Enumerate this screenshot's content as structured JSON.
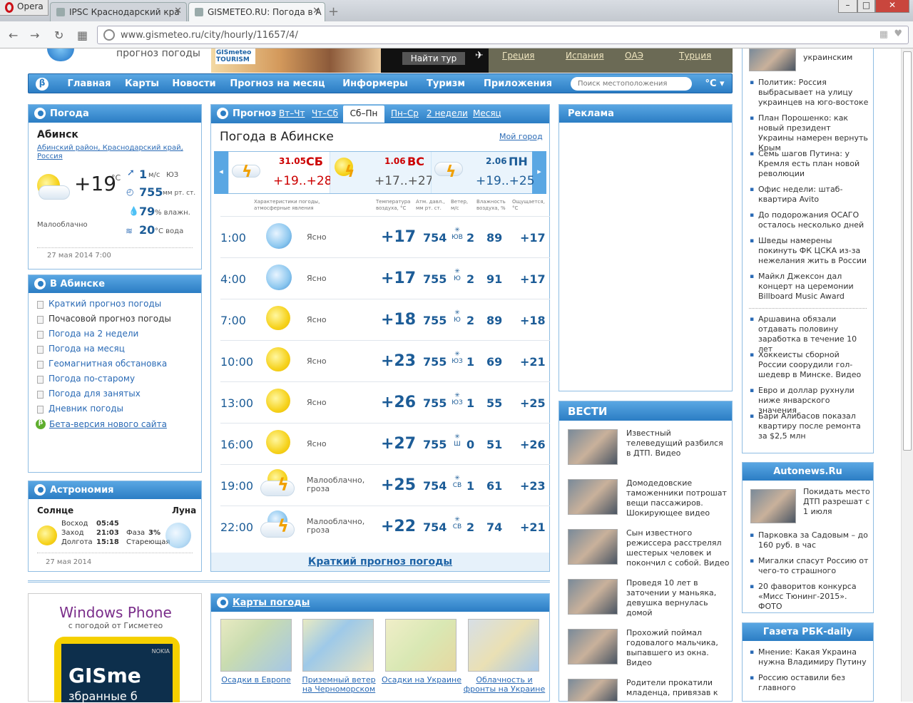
{
  "browser": {
    "opera_label": "Opera",
    "tabs": [
      {
        "label": "IPSC Краснодарский кра"
      },
      {
        "label": "GISMETEO.RU: Погода в А"
      }
    ],
    "url": "www.gismeteo.ru/city/hourly/11657/4/"
  },
  "header": {
    "tagline": "прогноз погоды",
    "ad_brand": "GISmeteo TOURISM",
    "find_tour": "Найти тур",
    "countries": [
      "Греция",
      "Испания",
      "ОАЭ",
      "Турция"
    ]
  },
  "nav": {
    "items": [
      "Главная",
      "Карты",
      "Новости",
      "Прогноз на месяц",
      "Информеры",
      "Туризм",
      "Приложения"
    ],
    "search_placeholder": "Поиск местоположения",
    "unit": "°C"
  },
  "weather_panel": {
    "title": "Погода",
    "city": "Абинск",
    "region": "Абинский район, Краснодарский край, Россия",
    "temp": "+19",
    "temp_unit": "°C",
    "condition": "Малооблачно",
    "wind_speed": "1",
    "wind_unit": "м/с",
    "wind_dir": "ЮЗ",
    "pressure": "755",
    "pressure_unit": "мм рт. ст.",
    "humidity": "79",
    "humidity_unit": "% влажн.",
    "water": "20",
    "water_unit": "°C вода",
    "date": "27 мая 2014 7:00"
  },
  "city_panel": {
    "title": "В Абинске",
    "links": [
      "Краткий прогноз погоды",
      "Почасовой прогноз погоды",
      "Погода на 2 недели",
      "Погода на месяц",
      "Геомагнитная обстановка",
      "Погода по-старому",
      "Погода для занятых",
      "Дневник погоды"
    ],
    "beta": "Бета-версия нового сайта"
  },
  "astro_panel": {
    "title": "Астрономия",
    "sun": "Солнце",
    "moon": "Луна",
    "rise_label": "Восход",
    "rise": "05:45",
    "set_label": "Заход",
    "set": "21:03",
    "len_label": "Долгота",
    "len": "15:18",
    "phase_label": "Фаза",
    "phase": "3%",
    "phase_name": "Стареющая",
    "date": "27 мая 2014"
  },
  "forecast": {
    "label": "Прогноз",
    "tabs": [
      "Вт–Чт",
      "Чт–Сб",
      "Сб–Пн",
      "Пн–Ср",
      "2 недели",
      "Месяц"
    ],
    "active_tab": "Сб–Пн",
    "title": "Погода в Абинске",
    "my_city": "Мой город",
    "days": [
      {
        "date": "31.05",
        "dow": "СБ",
        "range": "+19..+28"
      },
      {
        "date": "1.06",
        "dow": "ВС",
        "range": "+17..+27"
      },
      {
        "date": "2.06",
        "dow": "ПН",
        "range": "+19..+25"
      }
    ],
    "col_headers": {
      "cond": "Характеристики погоды, атмосферные явления",
      "temp": "Температура воздуха, °С",
      "pres": "Атм. давл., мм рт. ст.",
      "wind": "Ветер, м/с",
      "hum": "Влажность воздуха, %",
      "feel": "Ощущается, °С"
    },
    "rows": [
      {
        "time": "1:00",
        "desc": "Ясно",
        "temp": "+17",
        "pres": "754",
        "wdir": "ЮВ",
        "ws": "2",
        "hum": "89",
        "feel": "+17",
        "icon": "moon-icon"
      },
      {
        "time": "4:00",
        "desc": "Ясно",
        "temp": "+17",
        "pres": "755",
        "wdir": "Ю",
        "ws": "2",
        "hum": "91",
        "feel": "+17",
        "icon": "moon-icon"
      },
      {
        "time": "7:00",
        "desc": "Ясно",
        "temp": "+18",
        "pres": "755",
        "wdir": "Ю",
        "ws": "2",
        "hum": "89",
        "feel": "+18",
        "icon": "sun-icon"
      },
      {
        "time": "10:00",
        "desc": "Ясно",
        "temp": "+23",
        "pres": "755",
        "wdir": "ЮЗ",
        "ws": "1",
        "hum": "69",
        "feel": "+21",
        "icon": "sun-icon"
      },
      {
        "time": "13:00",
        "desc": "Ясно",
        "temp": "+26",
        "pres": "755",
        "wdir": "ЮЗ",
        "ws": "1",
        "hum": "55",
        "feel": "+25",
        "icon": "sun-icon"
      },
      {
        "time": "16:00",
        "desc": "Ясно",
        "temp": "+27",
        "pres": "755",
        "wdir": "Ш",
        "ws": "0",
        "hum": "51",
        "feel": "+26",
        "icon": "sun-icon"
      },
      {
        "time": "19:00",
        "desc": "Малооблачно, гроза",
        "temp": "+25",
        "pres": "754",
        "wdir": "СВ",
        "ws": "1",
        "hum": "61",
        "feel": "+23",
        "icon": "thunderstorm-icon"
      },
      {
        "time": "22:00",
        "desc": "Малооблачно, гроза",
        "temp": "+22",
        "pres": "754",
        "wdir": "СВ",
        "ws": "2",
        "hum": "74",
        "feel": "+21",
        "icon": "thunderstorm-icon"
      }
    ],
    "short_link": "Краткий прогноз погоды"
  },
  "maps_panel": {
    "title": "Карты погоды",
    "items": [
      "Осадки в Европе",
      "Приземный ветер на Черноморском",
      "Осадки на Украине",
      "Облачность и фронты на Украине"
    ]
  },
  "windows_phone": {
    "title": "Windows Phone",
    "subtitle": "с погодой от Гисметео",
    "brand": "NOKIA",
    "screen_text": "GISme",
    "screen_sub": "збранные б"
  },
  "ad_panel": {
    "title": "Реклама"
  },
  "vesti": {
    "title": "ВЕСТИ",
    "items": [
      "Известный телеведущий разбился в ДТП. Видео",
      "Домодедовские таможенники потрошат вещи пассажиров. Шокирующее видео",
      "Сын известного режиссера расстрелял шестерых человек и покончил с собой. Видео",
      "Проведя 10 лет в заточении у маньяка, девушка вернулась домой",
      "Прохожий поймал годовалого мальчика, выпавшего из окна. Видео",
      "Родители прокатили младенца, привязав к"
    ]
  },
  "news_col": {
    "top_fragment": "украинским",
    "items": [
      "Политик: Россия выбрасывает на улицу украинцев на юго-востоке",
      "План Порошенко: как новый президент Украины намерен вернуть Крым",
      "Семь шагов Путина: у Кремля есть план новой революции",
      "Офис недели: штаб-квартира Avito",
      "До подорожания ОСАГО осталось несколько дней",
      "Шведы намерены покинуть ФК ЦСКА из-за нежелания жить в России",
      "Майкл Джексон дал концерт на церемонии Billboard Music Award",
      "Аршавина обязали отдавать половину заработка в течение 10 лет",
      "Хоккеисты сборной России соорудили гол-шедевр в Минске. Видео",
      "Евро и доллар рухнули ниже январского значения",
      "Бари Алибасов показал квартиру после ремонта за $2,5 млн"
    ]
  },
  "autonews": {
    "title": "Autonews.Ru",
    "lead": "Покидать место ДТП разрешат с 1 июля",
    "items": [
      "Парковка за Садовым – до 160 руб. в час",
      "Мигалки спасут Россию от чего-то страшного",
      "20 фаворитов конкурса «Мисс Тюнинг-2015». ФОТО"
    ]
  },
  "rbc": {
    "title": "Газета РБК-daily",
    "items": [
      "Мнение: Какая Украина нужна Владимиру Путину",
      "Россию оставили без главного"
    ]
  }
}
